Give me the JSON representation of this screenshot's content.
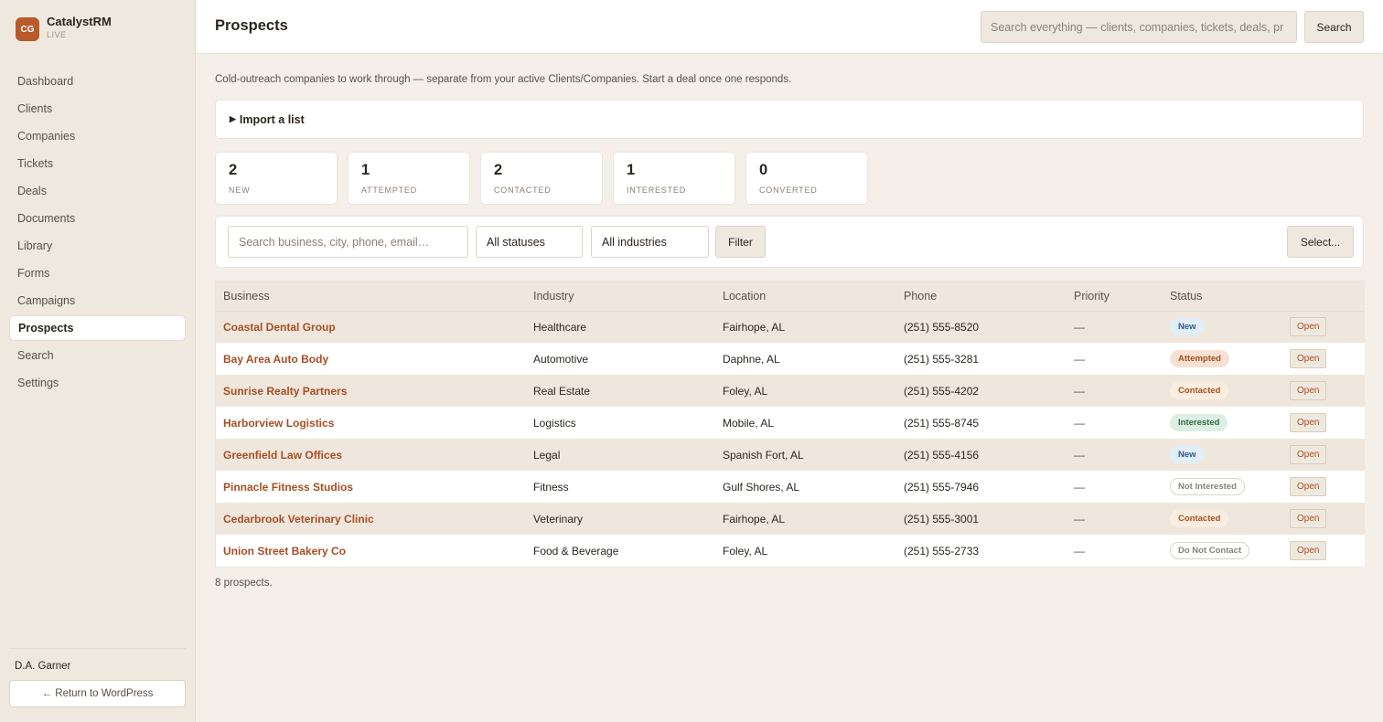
{
  "brand": {
    "initials": "CG",
    "name": "CatalystRM",
    "env": "LIVE"
  },
  "nav": [
    {
      "label": "Dashboard",
      "active": false
    },
    {
      "label": "Clients",
      "active": false
    },
    {
      "label": "Companies",
      "active": false
    },
    {
      "label": "Tickets",
      "active": false
    },
    {
      "label": "Deals",
      "active": false
    },
    {
      "label": "Documents",
      "active": false
    },
    {
      "label": "Library",
      "active": false
    },
    {
      "label": "Forms",
      "active": false
    },
    {
      "label": "Campaigns",
      "active": false
    },
    {
      "label": "Prospects",
      "active": true
    },
    {
      "label": "Search",
      "active": false
    },
    {
      "label": "Settings",
      "active": false
    }
  ],
  "user": {
    "name": "D.A. Garner",
    "return_label": "← Return to WordPress"
  },
  "header": {
    "title": "Prospects",
    "search_placeholder": "Search everything — clients, companies, tickets, deals, pr",
    "search_button": "Search"
  },
  "intro": "Cold-outreach companies to work through — separate from your active Clients/Companies. Start a deal once one responds.",
  "import": {
    "caret": "▶",
    "label": "Import a list"
  },
  "stats": [
    {
      "value": "2",
      "label": "NEW"
    },
    {
      "value": "1",
      "label": "ATTEMPTED"
    },
    {
      "value": "2",
      "label": "CONTACTED"
    },
    {
      "value": "1",
      "label": "INTERESTED"
    },
    {
      "value": "0",
      "label": "CONVERTED"
    }
  ],
  "filters": {
    "search_placeholder": "Search business, city, phone, email…",
    "status": "All statuses",
    "industry": "All industries",
    "filter_button": "Filter",
    "select_button": "Select..."
  },
  "table": {
    "columns": [
      "Business",
      "Industry",
      "Location",
      "Phone",
      "Priority",
      "Status",
      ""
    ],
    "open_label": "Open",
    "rows": [
      {
        "business": "Coastal Dental Group",
        "industry": "Healthcare",
        "location": "Fairhope, AL",
        "phone": "(251) 555-8520",
        "priority": "—",
        "status": "New"
      },
      {
        "business": "Bay Area Auto Body",
        "industry": "Automotive",
        "location": "Daphne, AL",
        "phone": "(251) 555-3281",
        "priority": "—",
        "status": "Attempted"
      },
      {
        "business": "Sunrise Realty Partners",
        "industry": "Real Estate",
        "location": "Foley, AL",
        "phone": "(251) 555-4202",
        "priority": "—",
        "status": "Contacted"
      },
      {
        "business": "Harborview Logistics",
        "industry": "Logistics",
        "location": "Mobile, AL",
        "phone": "(251) 555-8745",
        "priority": "—",
        "status": "Interested"
      },
      {
        "business": "Greenfield Law Offices",
        "industry": "Legal",
        "location": "Spanish Fort, AL",
        "phone": "(251) 555-4156",
        "priority": "—",
        "status": "New"
      },
      {
        "business": "Pinnacle Fitness Studios",
        "industry": "Fitness",
        "location": "Gulf Shores, AL",
        "phone": "(251) 555-7946",
        "priority": "—",
        "status": "Not Interested"
      },
      {
        "business": "Cedarbrook Veterinary Clinic",
        "industry": "Veterinary",
        "location": "Fairhope, AL",
        "phone": "(251) 555-3001",
        "priority": "—",
        "status": "Contacted"
      },
      {
        "business": "Union Street Bakery Co",
        "industry": "Food & Beverage",
        "location": "Foley, AL",
        "phone": "(251) 555-2733",
        "priority": "—",
        "status": "Do Not Contact"
      }
    ]
  },
  "status_colors": {
    "New": {
      "bg": "#e3edf7",
      "fg": "#2d5a8a",
      "border": "#e3edf7"
    },
    "Attempted": {
      "bg": "#f8e0d2",
      "fg": "#a84e24",
      "border": "#f8e0d2"
    },
    "Contacted": {
      "bg": "#fbeee0",
      "fg": "#a84e24",
      "border": "#fbeee0"
    },
    "Interested": {
      "bg": "#dcefe2",
      "fg": "#2f6b45",
      "border": "#dcefe2"
    },
    "Not Interested": {
      "bg": "#ffffff",
      "fg": "#8b8178",
      "border": "#ddd3c7"
    },
    "Do Not Contact": {
      "bg": "#ffffff",
      "fg": "#8b8178",
      "border": "#ddd3c7"
    }
  },
  "footer_count": "8 prospects."
}
